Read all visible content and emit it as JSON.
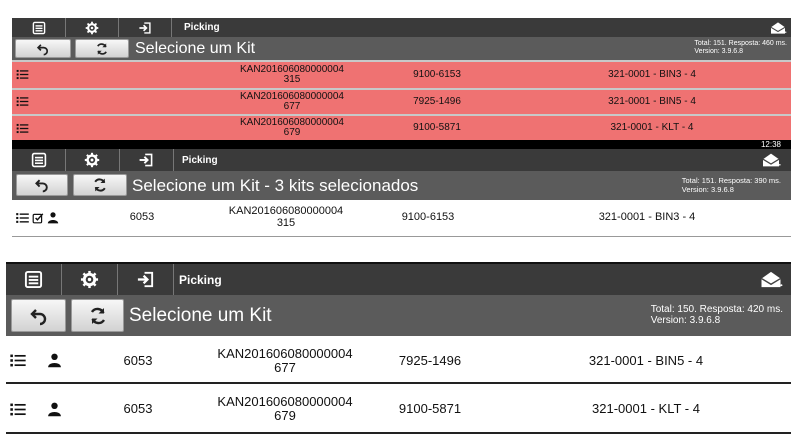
{
  "colors": {
    "toolbar_bg": "#3a3a3a",
    "header_bg": "#5b5b5b",
    "selected_row": "#ef7272",
    "white_row": "#ffffff",
    "text_white": "#ffffff"
  },
  "toolbar": {
    "menu_icon": "list-icon",
    "settings_icon": "gear-icon",
    "logout_icon": "sign-in-icon",
    "title": "Picking",
    "messages_icon": "envelope-icon"
  },
  "panel1": {
    "title": "Selecione um Kit",
    "stats": {
      "line1": "Total: 151. Resposta: 460 ms.",
      "line2": "Version: 3.9.6.8"
    },
    "rows": [
      {
        "kit_line1": "KAN201606080000004",
        "kit_line2": "315",
        "part": "9100-6153",
        "location": "321-0001 - BIN3 - 4"
      },
      {
        "kit_line1": "KAN201606080000004",
        "kit_line2": "677",
        "part": "7925-1496",
        "location": "321-0001 - BIN5 - 4"
      },
      {
        "kit_line1": "KAN201606080000004",
        "kit_line2": "679",
        "part": "9100-5871",
        "location": "321-0001 - KLT - 4"
      }
    ]
  },
  "panel2": {
    "clock": "12:38",
    "title": "Selecione um Kit - 3 kits selecionados",
    "stats": {
      "line1": "Total: 151. Resposta: 390 ms.",
      "line2": "Version: 3.9.6.8"
    },
    "rows": [
      {
        "number": "6053",
        "kit_line1": "KAN201606080000004",
        "kit_line2": "315",
        "part": "9100-6153",
        "location": "321-0001 - BIN3 - 4"
      }
    ]
  },
  "panel3": {
    "title": "Selecione um Kit",
    "stats": {
      "line1": "Total: 150. Resposta: 420 ms.",
      "line2": "Version: 3.9.6.8"
    },
    "rows": [
      {
        "number": "6053",
        "kit_line1": "KAN201606080000004",
        "kit_line2": "677",
        "part": "7925-1496",
        "location": "321-0001 - BIN5 - 4"
      },
      {
        "number": "6053",
        "kit_line1": "KAN201606080000004",
        "kit_line2": "679",
        "part": "9100-5871",
        "location": "321-0001 - KLT - 4"
      }
    ]
  }
}
